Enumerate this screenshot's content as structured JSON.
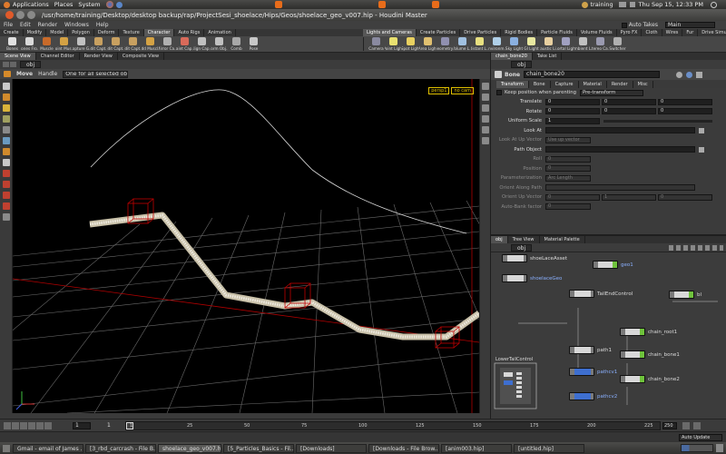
{
  "topbar": {
    "apps": "Applications",
    "places": "Places",
    "system": "System",
    "user": "training",
    "clock": "Thu Sep 15, 12:33 PM"
  },
  "window": {
    "title": "/usr/home/training/Desktop/desktop backup/rap/ProjectSesi_shoelace/Hips/Geos/shoelace_geo_v007.hip - Houdini Master"
  },
  "menubar": {
    "items": [
      "File",
      "Edit",
      "Render",
      "Windows",
      "Help"
    ],
    "auto_takes": "Auto Takes",
    "take": "Main"
  },
  "shelf": {
    "tabs_left": [
      "Create",
      "Modify",
      "Model",
      "Polygon",
      "Deform",
      "Texture",
      "Character",
      "Auto Rigs",
      "Animation"
    ],
    "tabs_right": [
      "Lights and Cameras",
      "Create Particles",
      "Drive Particles",
      "Rigid Bodies",
      "Particle Fluids",
      "Volume Fluids",
      "Pyro FX",
      "Cloth",
      "Wires",
      "Fur",
      "Drive Simulation"
    ],
    "tools_left": [
      "Bones",
      "Bones Fro...",
      "Muscle",
      "Point Mus...",
      "Capture G...",
      "Edit Capt...",
      "Edit Capt...",
      "Edit Capt...",
      "Add Muscl...",
      "Mirror Ca...",
      "Paint Cap...",
      "Align Cap...",
      "Form Obj...",
      "Comb",
      "Pose"
    ],
    "tools_right": [
      "Camera",
      "Point Light",
      "Spot Light",
      "Area Light",
      "Geometry...",
      "Volume L...",
      "Distant L...",
      "Environm...",
      "Sky Light",
      "GI Light",
      "Caustic Li...",
      "Portal Light",
      "Ambient L...",
      "Stereo Ca...",
      "Switcher"
    ]
  },
  "viewer": {
    "tabs": [
      "Scene View",
      "Channel Editor",
      "Render View",
      "Composite View"
    ],
    "path": "obj",
    "op_label": "Move",
    "handle": "Handle",
    "select_mode": "One for all selected objects",
    "persp": "persp1",
    "cam": "no cam"
  },
  "params": {
    "tabs": [
      "chain_bone20",
      "Take List"
    ],
    "path": "obj",
    "node_type": "Bone",
    "node_name": "chain_bone20",
    "subtabs": [
      "Transform",
      "Bone",
      "Capture",
      "Material",
      "Render",
      "Misc"
    ],
    "keep_pos": "Keep position when parenting",
    "pre_transform": "Pre-transform",
    "rows": [
      {
        "label": "Translate",
        "values": [
          "0",
          "0",
          "0"
        ],
        "dim": false
      },
      {
        "label": "Rotate",
        "values": [
          "0",
          "0",
          "0"
        ],
        "dim": false
      },
      {
        "label": "Uniform Scale",
        "values": [
          "1"
        ],
        "dim": false
      },
      {
        "label": "Look At",
        "values": [
          ""
        ],
        "dim": false
      },
      {
        "label": "Look At Up Vector",
        "values": [
          "Use up vector"
        ],
        "dim": true
      },
      {
        "label": "Path Object",
        "values": [
          ""
        ],
        "dim": false
      },
      {
        "label": "Roll",
        "values": [
          "0"
        ],
        "dim": true
      },
      {
        "label": "Position",
        "values": [
          "0"
        ],
        "dim": true
      },
      {
        "label": "Parameterization",
        "values": [
          "Arc Length"
        ],
        "dim": true
      },
      {
        "label": "Orient Along Path",
        "values": [
          ""
        ],
        "dim": true
      },
      {
        "label": "Orient Up Vector",
        "values": [
          "0",
          "1",
          "0"
        ],
        "dim": true
      },
      {
        "label": "Auto-Bank factor",
        "values": [
          "0"
        ],
        "dim": true
      }
    ]
  },
  "network": {
    "tabs": [
      "obj",
      "Tree View",
      "Material Palette"
    ],
    "path": "obj",
    "nodes": [
      {
        "label": "shoeLaceAsset",
        "style": "normal",
        "blue": false
      },
      {
        "label": "geo1",
        "style": "g",
        "blue": true
      },
      {
        "label": "shoelaceGeo",
        "style": "normal",
        "blue": true
      },
      {
        "label": "TailEndControl",
        "style": "normal",
        "blue": false
      },
      {
        "label": "bl",
        "style": "g",
        "blue": false
      },
      {
        "label": "chain_root1",
        "style": "g",
        "blue": false
      },
      {
        "label": "path1",
        "style": "normal",
        "blue": false
      },
      {
        "label": "chain_bone1",
        "style": "g",
        "blue": false
      },
      {
        "label": "pathcv1",
        "style": "b",
        "blue": true
      },
      {
        "label": "chain_bone2",
        "style": "g",
        "blue": false
      },
      {
        "label": "pathcv2",
        "style": "b",
        "blue": true
      }
    ],
    "subnet_label": "LowerTailControl"
  },
  "timeline": {
    "ticks": [
      "1",
      "25",
      "50",
      "75",
      "100",
      "125",
      "150",
      "175",
      "200",
      "225"
    ],
    "current": "1",
    "start": "1",
    "end": "250",
    "auto_update": "Auto Update"
  },
  "taskbar": {
    "items": [
      "Gmail - email of James ...",
      "[3_rbd_carcrash - File B...",
      "shoelace_geo_v007.hip",
      "[5_Particles_Basics - Fil...",
      "[Downloads]",
      "[Downloads - File Brow...",
      "[anim003.hip]",
      "[untitled.hip]"
    ]
  },
  "colors": {
    "bg": "#3a3a3a",
    "viewport": "#000000",
    "grid": "#666666",
    "accent_blue": "#3e6fd0",
    "node_green": "#6fc23c",
    "bbox_red": "#c00000",
    "persp_yellow": "#e0c000"
  }
}
